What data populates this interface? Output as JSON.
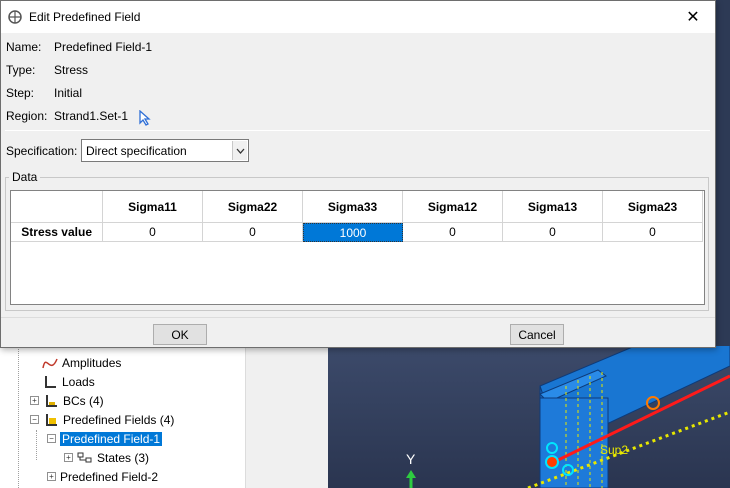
{
  "dialog": {
    "title": "Edit Predefined Field",
    "fields": [
      {
        "key": "Name:",
        "value": "Predefined Field-1"
      },
      {
        "key": "Type:",
        "value": "Stress"
      },
      {
        "key": "Step:",
        "value": "Initial"
      },
      {
        "key": "Region:",
        "value": "Strand1.Set-1"
      }
    ],
    "specification": {
      "label": "Specification:",
      "selected": "Direct specification"
    },
    "group_title": "Data",
    "table": {
      "columns": [
        "Sigma11",
        "Sigma22",
        "Sigma33",
        "Sigma12",
        "Sigma13",
        "Sigma23"
      ],
      "row_label": "Stress value",
      "values": [
        "0",
        "0",
        "1000",
        "0",
        "0",
        "0"
      ],
      "active_index": 2
    },
    "ok_label": "OK",
    "cancel_label": "Cancel"
  },
  "tree": {
    "items": [
      {
        "label": "Amplitudes",
        "icon": "amplitude-icon"
      },
      {
        "label": "Loads",
        "icon": "load-icon"
      },
      {
        "label": "BCs (4)",
        "icon": "bc-icon"
      },
      {
        "label": "Predefined Fields (4)",
        "icon": "predefined-field-icon"
      },
      {
        "label": "Predefined Field-1",
        "icon": "none"
      },
      {
        "label": "States (3)",
        "icon": "states-icon"
      },
      {
        "label": "Predefined Field-2",
        "icon": "none"
      }
    ]
  },
  "viewport": {
    "axis_label": "Y",
    "annotation": "Sup2"
  },
  "colors": {
    "accent": "#0078d7",
    "beam": "#1565c0",
    "beam_line": "#ff1a1a",
    "dotted": "#e8e800"
  }
}
